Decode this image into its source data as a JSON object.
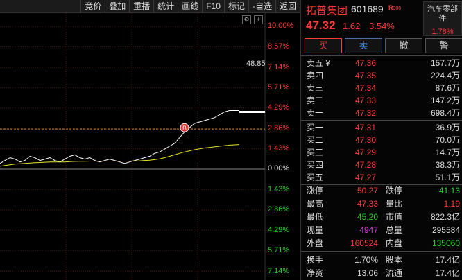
{
  "toolbar": [
    "竞价",
    "叠加",
    "重播",
    "统计",
    "画线",
    "F10",
    "标记",
    "-自选",
    "返回"
  ],
  "chart": {
    "mini_icons": [
      "settings-icon",
      "add-icon"
    ],
    "current_price_tag": "48.85",
    "pct_labels": [
      "10.00%",
      "8.57%",
      "7.14%",
      "5.71%",
      "4.29%",
      "2.86%",
      "1.43%",
      "0.00%",
      "1.43%",
      "2.86%",
      "4.29%",
      "5.71%",
      "7.14%"
    ],
    "marker": "B",
    "colors": {
      "price_line": "#ffffff",
      "avg_line": "#e6e62a",
      "ref_line": "#d08a2a",
      "grid": "#4a1010"
    }
  },
  "chart_data": {
    "type": "line",
    "ylim": [
      -7.14,
      10.0
    ],
    "series": [
      {
        "values": [
          0.4,
          0.6,
          0.8,
          0.7,
          0.5,
          0.6,
          0.9,
          0.8,
          0.6,
          0.7,
          0.8,
          0.6,
          0.5,
          0.7,
          0.9,
          1.0,
          0.8,
          0.7,
          0.8,
          0.6,
          0.5,
          0.6,
          0.7,
          0.6,
          0.5,
          0.4,
          0.5,
          0.6,
          0.7,
          0.8,
          0.9,
          1.1,
          1.2,
          1.4,
          1.6,
          1.8,
          2.2,
          2.6,
          2.9,
          3.2,
          3.3,
          3.4,
          3.5,
          3.6,
          3.8,
          4.0,
          4.1,
          4.1,
          4.1
        ]
      },
      {
        "values": [
          0.2,
          0.25,
          0.3,
          0.35,
          0.38,
          0.4,
          0.42,
          0.45,
          0.46,
          0.48,
          0.5,
          0.5,
          0.5,
          0.5,
          0.52,
          0.54,
          0.55,
          0.55,
          0.56,
          0.56,
          0.56,
          0.56,
          0.56,
          0.56,
          0.56,
          0.56,
          0.56,
          0.57,
          0.58,
          0.6,
          0.62,
          0.66,
          0.72,
          0.8,
          0.9,
          1.0,
          1.1,
          1.2,
          1.28,
          1.36,
          1.42,
          1.48,
          1.52,
          1.56,
          1.6,
          1.64,
          1.68,
          1.7,
          1.72
        ]
      }
    ]
  },
  "stock": {
    "name": "拓普集团",
    "code": "601689",
    "r_badge": "R",
    "r_sub": "300",
    "last": "47.32",
    "change": "1.62",
    "change_pct": "3.54%",
    "sector": "汽车零部件",
    "sector_change": "1.78%"
  },
  "trade_buttons": [
    "买",
    "卖",
    "撤",
    "警"
  ],
  "asks": [
    {
      "label": "卖五 ¥",
      "price": "47.36",
      "vol": "157.7万"
    },
    {
      "label": "卖四",
      "price": "47.35",
      "vol": "224.4万"
    },
    {
      "label": "卖三",
      "price": "47.34",
      "vol": "87.6万"
    },
    {
      "label": "卖二",
      "price": "47.33",
      "vol": "147.2万"
    },
    {
      "label": "卖一",
      "price": "47.32",
      "vol": "698.4万"
    }
  ],
  "bids": [
    {
      "label": "买一",
      "price": "47.31",
      "vol": "36.9万"
    },
    {
      "label": "买二",
      "price": "47.30",
      "vol": "70.0万"
    },
    {
      "label": "买三",
      "price": "47.29",
      "vol": "14.7万"
    },
    {
      "label": "买四",
      "price": "47.28",
      "vol": "38.3万"
    },
    {
      "label": "买五",
      "price": "47.27",
      "vol": "51.1万"
    }
  ],
  "stats": [
    {
      "k1": "涨停",
      "v1": "50.27",
      "c1": "red",
      "k2": "跌停",
      "v2": "41.13",
      "c2": "green"
    },
    {
      "k1": "最高",
      "v1": "47.33",
      "c1": "red",
      "k2": "量比",
      "v2": "1.19",
      "c2": "red"
    },
    {
      "k1": "最低",
      "v1": "45.20",
      "c1": "green",
      "k2": "市值",
      "v2": "822.3亿",
      "c2": "white"
    },
    {
      "k1": "现量",
      "v1": "4947",
      "c1": "purple",
      "k2": "总量",
      "v2": "295584",
      "c2": "white"
    },
    {
      "k1": "外盘",
      "v1": "160524",
      "c1": "red",
      "k2": "内盘",
      "v2": "135060",
      "c2": "green"
    },
    {
      "k1": "换手",
      "v1": "1.70%",
      "c1": "white",
      "k2": "股本",
      "v2": "17.4亿",
      "c2": "white"
    },
    {
      "k1": "净资",
      "v1": "13.06",
      "c1": "white",
      "k2": "流通",
      "v2": "17.4亿",
      "c2": "white"
    }
  ]
}
